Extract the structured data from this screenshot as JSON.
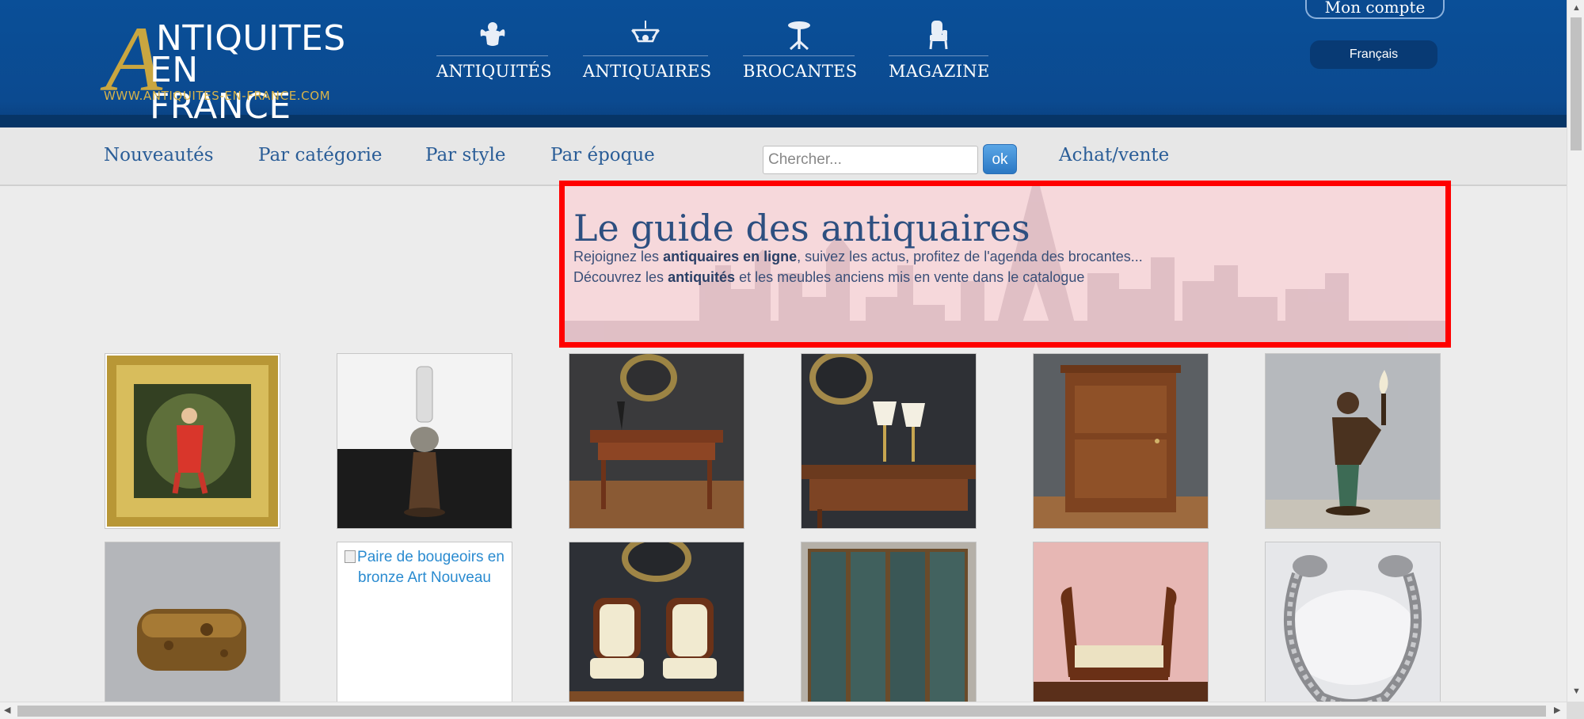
{
  "header": {
    "logo": {
      "big_letter": "A",
      "line1": "NTIQUITES",
      "line2": "EN FRANCE",
      "url": "WWW.ANTIQUITES-EN-FRANCE.COM"
    },
    "nav": [
      {
        "label": "ANTIQUITÉS",
        "icon": "cherub-icon"
      },
      {
        "label": "ANTIQUAIRES",
        "icon": "chandelier-icon"
      },
      {
        "label": "BROCANTES",
        "icon": "gueridon-table-icon"
      },
      {
        "label": "MAGAZINE",
        "icon": "armchair-icon"
      }
    ],
    "account_label": "Mon compte",
    "language_label": "Français"
  },
  "subnav": {
    "links": [
      "Nouveautés",
      "Par catégorie",
      "Par style",
      "Par époque"
    ],
    "search_placeholder": "Chercher...",
    "search_button": "ok",
    "buy_sell": "Achat/vente"
  },
  "guide": {
    "title": "Le guide des antiquaires",
    "line1": {
      "before": "Rejoignez les ",
      "bold": "antiquaires en ligne",
      "after": ", suivez les actus, profitez de l'agenda des brocantes..."
    },
    "line2": {
      "before": "Découvrez les ",
      "bold": "antiquités",
      "after": " et les meubles anciens mis en vente dans le catalogue"
    }
  },
  "products": [
    {
      "subject": "framed-painting"
    },
    {
      "subject": "oil-lamp"
    },
    {
      "subject": "writing-desk"
    },
    {
      "subject": "desk-with-lamps"
    },
    {
      "subject": "wooden-cabinet"
    },
    {
      "subject": "bronze-statue-lamp"
    },
    {
      "subject": "wooden-box"
    },
    {
      "subject": "broken-image",
      "alt": "Paire de bougeoirs en bronze Art Nouveau"
    },
    {
      "subject": "pair-of-chairs"
    },
    {
      "subject": "folding-screen"
    },
    {
      "subject": "daybed"
    },
    {
      "subject": "silver-bracelet"
    }
  ],
  "colors": {
    "header_blue": "#0a4f98",
    "gold": "#c9a640",
    "link_blue": "#2a5d97",
    "highlight_red": "#ff0000"
  }
}
